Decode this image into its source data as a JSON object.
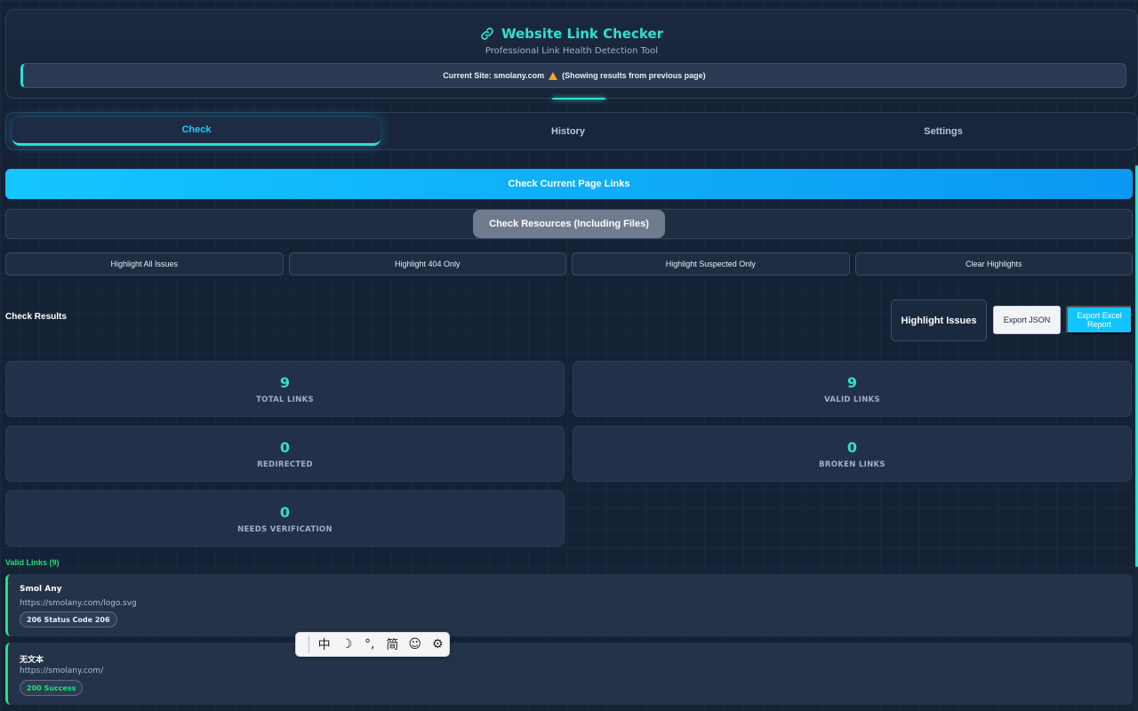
{
  "header": {
    "title": "Website Link Checker",
    "subtitle": "Professional Link Health Detection Tool",
    "current_site_label": "Current Site: smolany.com",
    "current_site_note": "(Showing results from previous page)"
  },
  "tabs": [
    {
      "label": "Check"
    },
    {
      "label": "History"
    },
    {
      "label": "Settings"
    }
  ],
  "actions": {
    "check_page": "Check Current Page Links",
    "check_resources": "Check Resources (Including Files)",
    "highlight_all": "Highlight All Issues",
    "highlight_404": "Highlight 404 Only",
    "highlight_suspected": "Highlight Suspected Only",
    "clear_highlights": "Clear Highlights"
  },
  "results": {
    "title": "Check Results",
    "highlight_issues": "Highlight Issues",
    "export_json": "Export JSON",
    "export_excel": "Export Excel Report"
  },
  "stats": {
    "total": {
      "value": "9",
      "label": "TOTAL LINKS"
    },
    "valid": {
      "value": "9",
      "label": "VALID LINKS"
    },
    "redirected": {
      "value": "0",
      "label": "REDIRECTED"
    },
    "broken": {
      "value": "0",
      "label": "BROKEN LINKS"
    },
    "verify": {
      "value": "0",
      "label": "NEEDS VERIFICATION"
    }
  },
  "valid_links": {
    "title": "Valid Links (9)",
    "items": [
      {
        "name": "Smol Any",
        "url": "https://smolany.com/logo.svg",
        "status": "206 Status Code 206",
        "status_color": "#e6edf7"
      },
      {
        "name": "无文本",
        "url": "https://smolany.com/",
        "status": "200 Success",
        "status_color": "#22e07a"
      }
    ]
  },
  "ime": {
    "items": [
      "中",
      "☽",
      "°,",
      "简",
      "☺",
      "⚙"
    ]
  },
  "colors": {
    "accent": "#2fe0cf",
    "primary": "#14c6ff",
    "success": "#22e07a",
    "warning": "#f5a623"
  }
}
